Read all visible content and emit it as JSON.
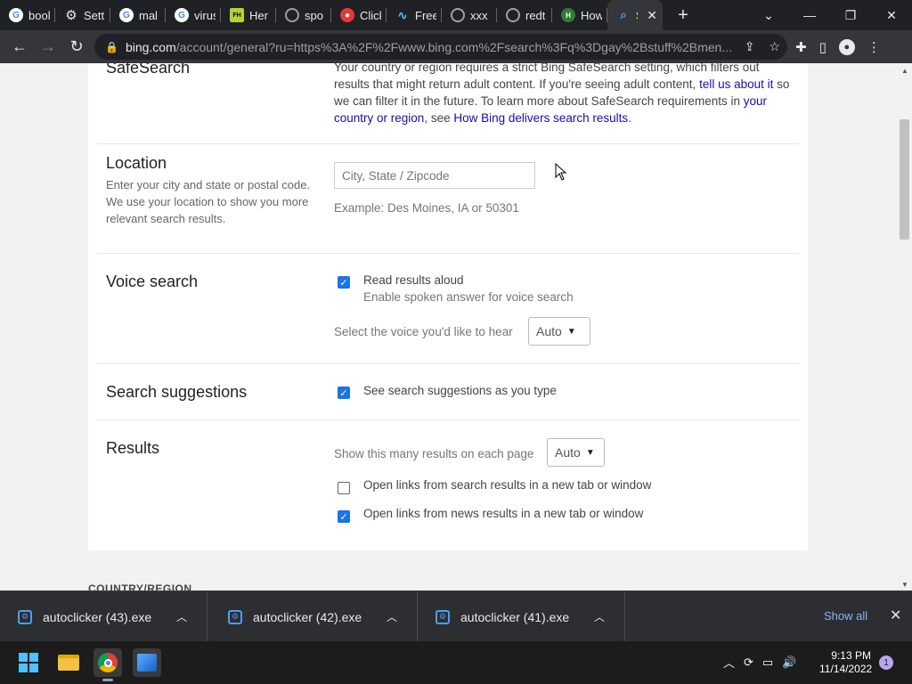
{
  "browser": {
    "tabs": [
      {
        "title": "bool",
        "icon": "google-icon"
      },
      {
        "title": "Setti",
        "icon": "gear-icon"
      },
      {
        "title": "mal",
        "icon": "google-icon"
      },
      {
        "title": "virus",
        "icon": "google-icon"
      },
      {
        "title": "Her",
        "icon": "filehippo-icon"
      },
      {
        "title": "spo",
        "icon": "globe-icon"
      },
      {
        "title": "Click",
        "icon": "red-icon"
      },
      {
        "title": "Free",
        "icon": "wave-icon"
      },
      {
        "title": "xxx",
        "icon": "globe-icon"
      },
      {
        "title": "redt",
        "icon": "globe-icon"
      },
      {
        "title": "How",
        "icon": "green-icon"
      },
      {
        "title": "S",
        "icon": "bing-icon",
        "active": true
      }
    ],
    "new_tab": "+",
    "url_host": "bing.com",
    "url_rest": "/account/general?ru=https%3A%2F%2Fwww.bing.com%2Fsearch%3Fq%3Dgay%2Bstuff%2Bmen..."
  },
  "settings": {
    "safesearch": {
      "title": "SafeSearch",
      "text_1": "Your country or region requires a strict Bing SafeSearch setting, which filters out results that might return adult content. If you're seeing adult content, ",
      "link_1": "tell us about it",
      "text_2": " so we can filter it in the future. To learn more about SafeSearch requirements in ",
      "link_2": "your country or region",
      "text_3": ", see ",
      "link_3": "How Bing delivers search results",
      "text_4": "."
    },
    "location": {
      "title": "Location",
      "description": "Enter your city and state or postal code. We use your location to show you more relevant search results.",
      "placeholder": "City, State / Zipcode",
      "example": "Example: Des Moines, IA or 50301"
    },
    "voice": {
      "title": "Voice search",
      "checkbox_label": "Read results aloud",
      "checkbox_hint": "Enable spoken answer for voice search",
      "checked": true,
      "voice_label": "Select the voice you'd like to hear",
      "voice_value": "Auto"
    },
    "suggestions": {
      "title": "Search suggestions",
      "checkbox_label": "See search suggestions as you type",
      "checked": true
    },
    "results": {
      "title": "Results",
      "count_label": "Show this many results on each page",
      "count_value": "Auto",
      "new_tab_search": "Open links from search results in a new tab or window",
      "new_tab_search_checked": false,
      "new_tab_news": "Open links from news results in a new tab or window",
      "new_tab_news_checked": true
    },
    "country_heading": "COUNTRY/REGION"
  },
  "downloads": {
    "items": [
      "autoclicker (43).exe",
      "autoclicker (42).exe",
      "autoclicker (41).exe"
    ],
    "show_all": "Show all"
  },
  "taskbar": {
    "time": "9:13 PM",
    "date": "11/14/2022",
    "notifications": "1"
  },
  "colors": {
    "link": "#1a0dab",
    "checkbox": "#1a73e8",
    "accent": "#4b9ef8"
  }
}
